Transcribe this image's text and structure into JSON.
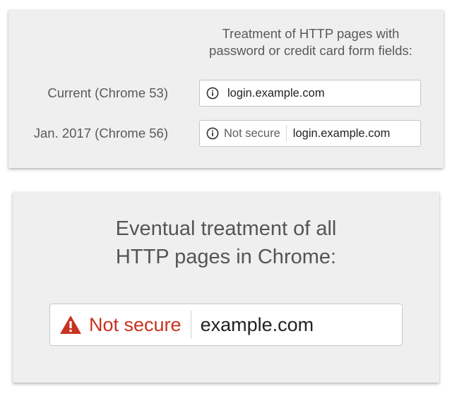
{
  "top_card": {
    "heading_line1": "Treatment of HTTP pages with",
    "heading_line2": "password or credit card form fields:",
    "rows": [
      {
        "label": "Current (Chrome 53)",
        "icon": "info-icon",
        "url": "login.example.com"
      },
      {
        "label": "Jan. 2017 (Chrome 56)",
        "icon": "info-icon",
        "chip": "Not secure",
        "url": "login.example.com"
      }
    ]
  },
  "bottom_card": {
    "heading_line1": "Eventual treatment of all",
    "heading_line2": "HTTP pages in Chrome:",
    "icon": "warning-triangle-icon",
    "chip": "Not secure",
    "url": "example.com"
  },
  "colors": {
    "card_background": "#efefef",
    "warning_red": "#c8321f",
    "text_gray": "#5a5a5a",
    "omnibox_border": "#c4c4c4"
  }
}
